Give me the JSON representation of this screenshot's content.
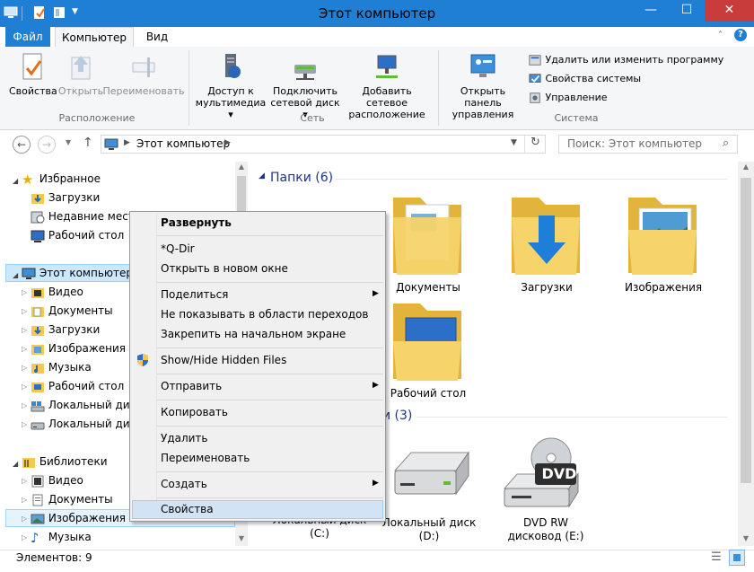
{
  "window": {
    "title": "Этот компьютер"
  },
  "ribbon": {
    "tabs": [
      "Файл",
      "Компьютер",
      "Вид"
    ],
    "buttons": {
      "properties": "Свойства",
      "open": "Открыть",
      "rename": "Переименовать",
      "media_l1": "Доступ к",
      "media_l2": "мультимедиа",
      "map_l1": "Подключить",
      "map_l2": "сетевой диск",
      "addnet_l1": "Добавить сетевое",
      "addnet_l2": "расположение",
      "cpanel_l1": "Открыть панель",
      "cpanel_l2": "управления",
      "uninstall": "Удалить или изменить программу",
      "sysprops": "Свойства системы",
      "manage": "Управление"
    },
    "groups": {
      "location": "Расположение",
      "network": "Сеть",
      "system": "Система"
    }
  },
  "address": {
    "path": "Этот компьютер",
    "search_placeholder": "Поиск: Этот компьютер"
  },
  "nav": {
    "favorites": "Избранное",
    "downloads": "Загрузки",
    "recent": "Недавние места",
    "desktop": "Рабочий стол",
    "this_pc": "Этот компьютер",
    "pc_items": [
      "Видео",
      "Документы",
      "Загрузки",
      "Изображения",
      "Музыка",
      "Рабочий стол",
      "Локальный диск",
      "Локальный диск"
    ],
    "libraries": "Библиотеки",
    "lib_items": [
      "Видео",
      "Документы",
      "Изображения",
      "Музыка"
    ]
  },
  "content": {
    "folders_header": "Папки (6)",
    "devices_header_tail": "и (3)",
    "folders": [
      "Документы",
      "Загрузки",
      "Изображения",
      "Рабочий стол"
    ],
    "drives": [
      {
        "l1": "Локальный диск",
        "l2": "(C:)"
      },
      {
        "l1": "Локальный диск",
        "l2": "(D:)"
      },
      {
        "l1": "DVD RW",
        "l2": "дисковод (E:)"
      }
    ],
    "dvd_text": "DVD"
  },
  "context_menu": {
    "expand": "Развернуть",
    "qdir": "*Q-Dir",
    "open_new": "Открыть в новом окне",
    "share": "Поделиться",
    "hide_nav": "Не показывать в области переходов",
    "pin": "Закрепить на начальном экране",
    "hidden_files": "Show/Hide Hidden Files",
    "send_to": "Отправить",
    "copy": "Копировать",
    "delete": "Удалить",
    "rename": "Переименовать",
    "create": "Создать",
    "properties": "Свойства"
  },
  "status": {
    "items": "Элементов: 9"
  },
  "colors": {
    "accent": "#1e7fd4",
    "close": "#c83c3c",
    "header_text": "#1e3287",
    "folder": "#f3c94f",
    "selection": "#cce8ff"
  }
}
